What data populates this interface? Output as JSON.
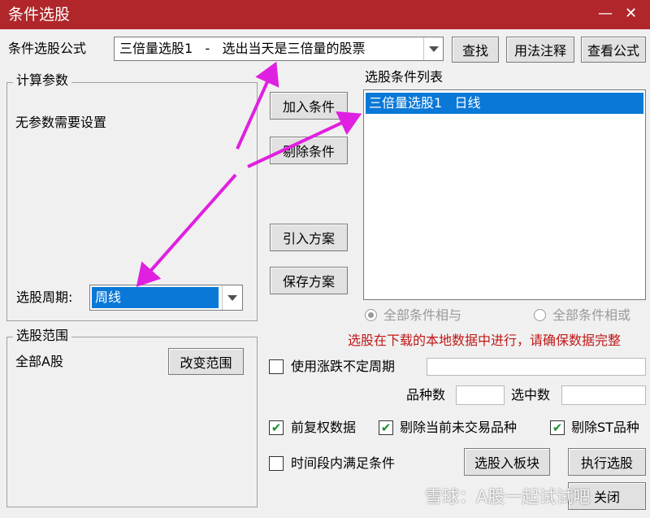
{
  "window": {
    "title": "条件选股",
    "minimize": "—",
    "close": "✕"
  },
  "formula": {
    "label": "条件选股公式",
    "value": "三倍量选股1   -   选出当天是三倍量的股票",
    "find_button": "查找",
    "usage_button": "用法注释",
    "view_button": "查看公式"
  },
  "params": {
    "legend": "计算参数",
    "text": "无参数需要设置"
  },
  "period": {
    "label": "选股周期:",
    "value": "周线"
  },
  "range": {
    "legend": "选股范围",
    "text": "全部A股",
    "button": "改变范围"
  },
  "buttons": {
    "add": "加入条件",
    "remove": "剔除条件",
    "import": "引入方案",
    "save": "保存方案"
  },
  "conditions": {
    "title": "选股条件列表",
    "items": [
      "三倍量选股1   日线"
    ]
  },
  "logic": {
    "and": "全部条件相与",
    "or": "全部条件相或",
    "selected": "and"
  },
  "notice": "选股在下载的本地数据中进行，请确保数据完整",
  "options": {
    "variable_period": {
      "label": "使用涨跌不定周期",
      "checked": false
    },
    "count_label": "品种数",
    "selected_label": "选中数",
    "adjusted": {
      "label": "前复权数据",
      "checked": true
    },
    "exclude_untraded": {
      "label": "剔除当前未交易品种",
      "checked": true
    },
    "exclude_st": {
      "label": "剔除ST品种",
      "checked": true
    },
    "time_range": {
      "label": "时间段内满足条件",
      "checked": false
    }
  },
  "actions": {
    "to_block": "选股入板块",
    "execute": "执行选股",
    "close": "关闭"
  },
  "watermark": "雪球：A股一起试试吧",
  "colors": {
    "titlebar": "#b0262a",
    "selection": "#0a78d7",
    "notice": "#c01818",
    "annotation": "#e020e0"
  }
}
